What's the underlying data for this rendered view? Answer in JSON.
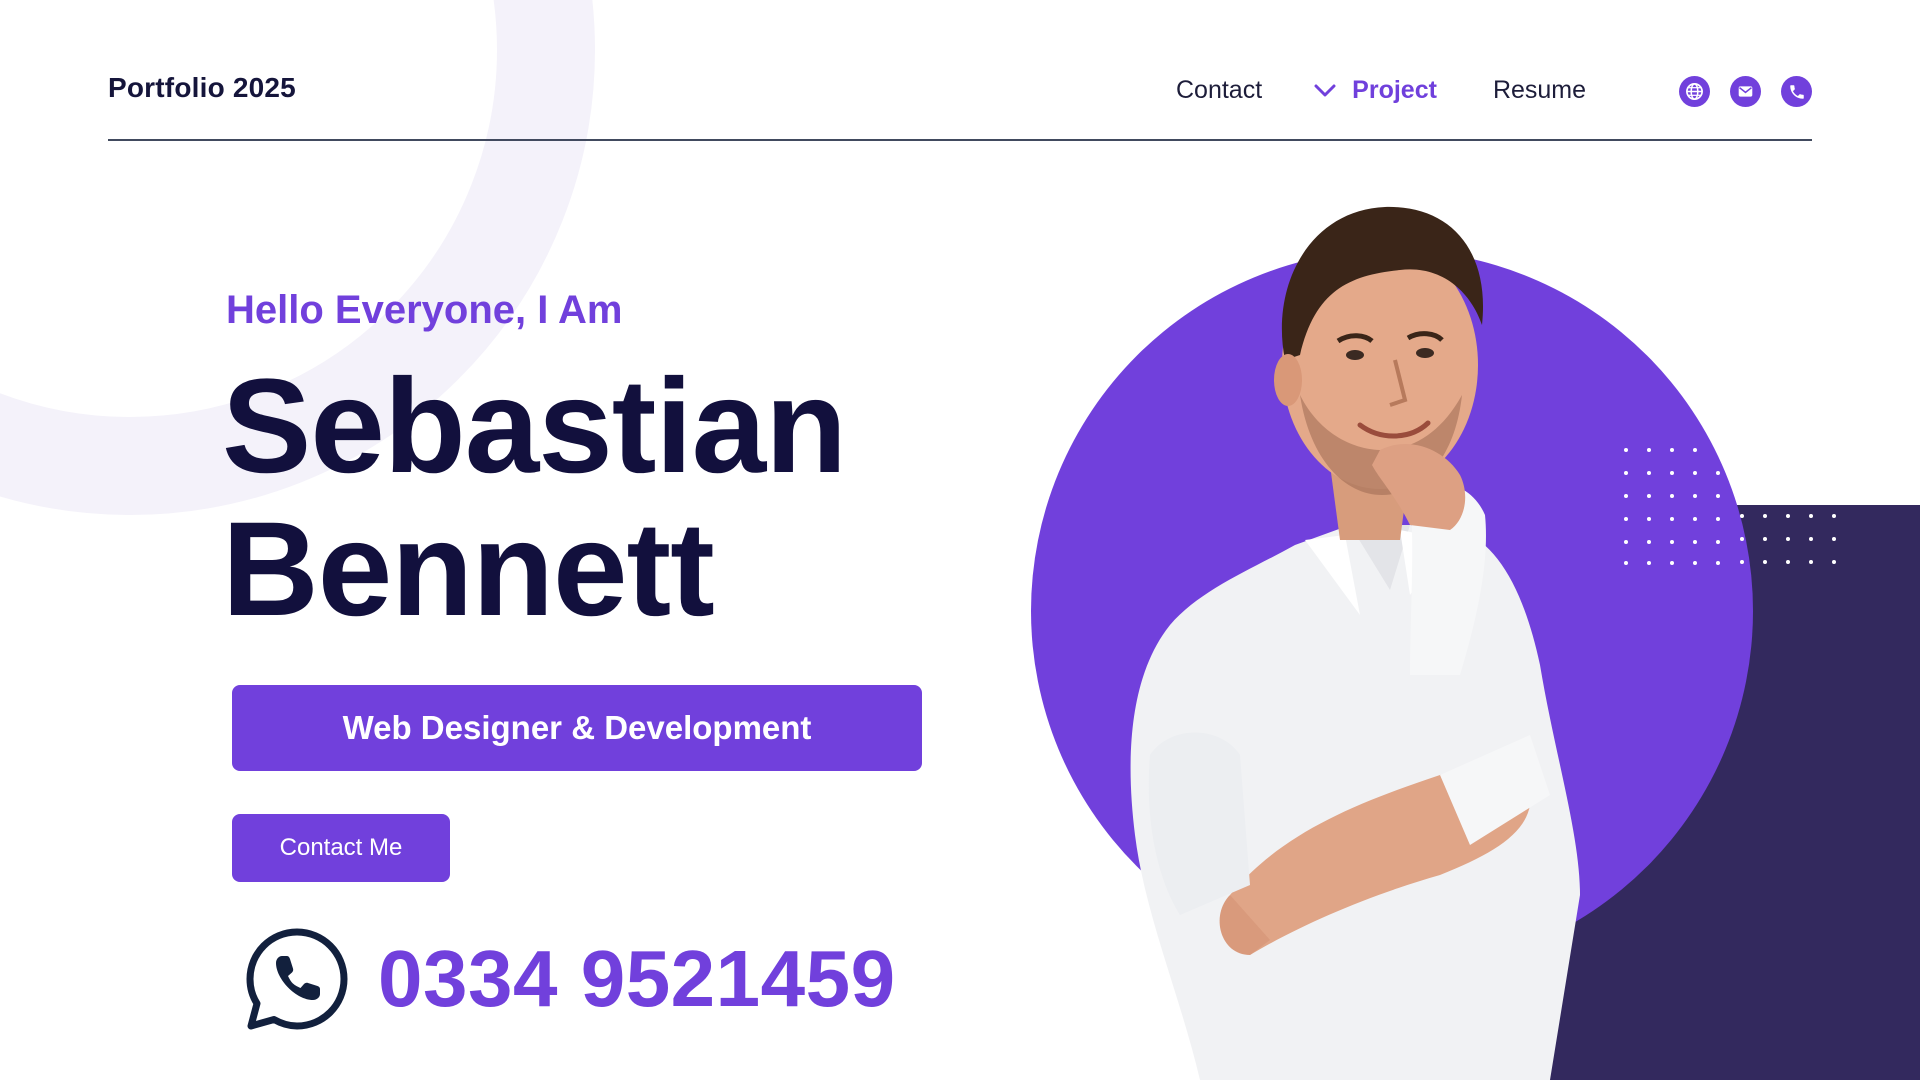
{
  "header": {
    "brand": "Portfolio 2025",
    "nav": {
      "contact": "Contact",
      "project": "Project",
      "resume": "Resume"
    },
    "social_icons": [
      "globe-icon",
      "mail-icon",
      "phone-icon"
    ]
  },
  "hero": {
    "greeting": "Hello Everyone, I Am",
    "first_name": "Sebastian",
    "last_name": "Bennett",
    "role": "Web Designer & Development",
    "contact_button": "Contact Me",
    "phone": "0334 9521459"
  },
  "colors": {
    "accent": "#7140dc",
    "navy": "#12103d",
    "dark_panel": "#33295e",
    "ring": "#f4f2fa"
  }
}
